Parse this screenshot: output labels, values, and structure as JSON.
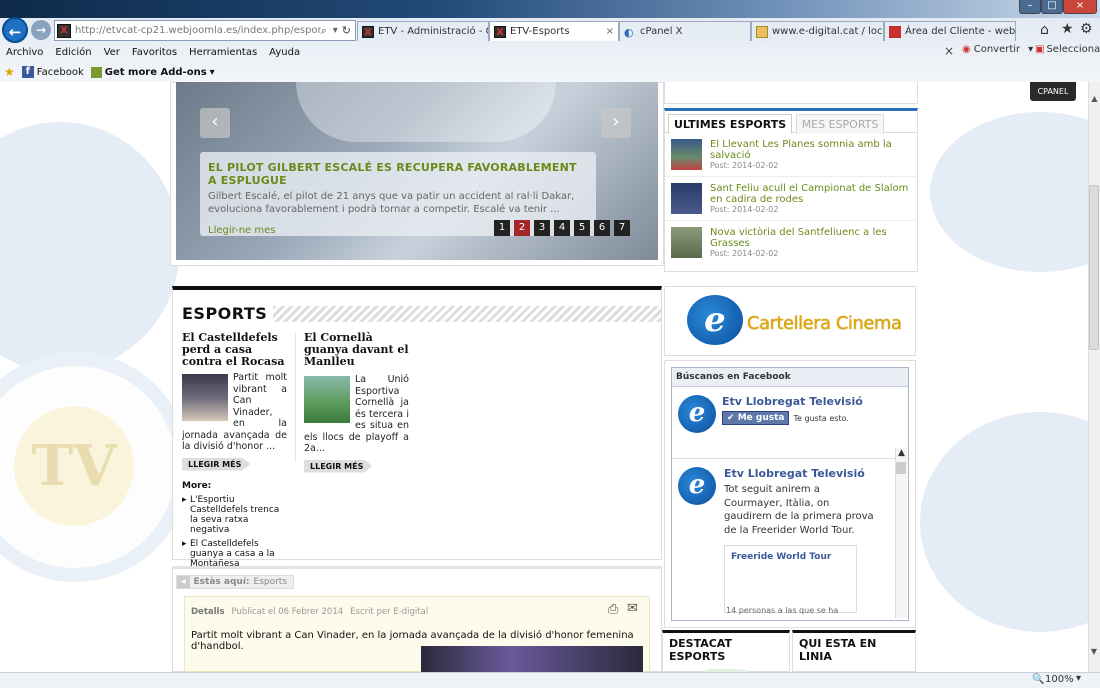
{
  "browser": {
    "address": "http://etvcat-cp21.webjoomla.es/index.php/esports",
    "tabs": [
      {
        "label": "ETV - Administració - Ges..."
      },
      {
        "label": "ETV-Esports"
      },
      {
        "label": "cPanel X"
      },
      {
        "label": "www.e-digital.cat / localh..."
      },
      {
        "label": "Área del Cliente - webem..."
      }
    ],
    "menu": [
      "Archivo",
      "Edición",
      "Ver",
      "Favoritos",
      "Herramientas",
      "Ayuda"
    ],
    "favorites": {
      "facebook": "Facebook",
      "addons": "Get more Add-ons"
    },
    "toolbar_right": {
      "convert": "Convertir",
      "select": "Seleccionar"
    },
    "zoom": "100%",
    "tab_close": "×",
    "close_glyph": "×"
  },
  "cpanel_badge": "CPANEL",
  "slider": {
    "headline": "EL PILOT GILBERT ESCALÉ ES RECUPERA FAVORABLEMENT A ESPLUGUE",
    "text": "Gilbert Escalé, el pilot de 21 anys que va patir un accident al ral·li Dakar, evoluciona favorablement i podrà tornar a competir. Escalé va tenir ...",
    "link": "Llegir-ne mes",
    "pages": [
      "1",
      "2",
      "3",
      "4",
      "5",
      "6",
      "7"
    ],
    "active_page": "2"
  },
  "sidebar_news": {
    "tab_active": "ULTIMES ESPORTS",
    "tab_inactive": "MES ESPORTS",
    "items": [
      {
        "title": "El Llevant Les Planes somnia amb la salvació",
        "date": "Post: 2014-02-02"
      },
      {
        "title": "Sant Feliu acull el Campionat de Slalom en cadira de rodes",
        "date": "Post: 2014-02-02"
      },
      {
        "title": "Nova victòria del Santfeliuenc a les Grasses",
        "date": "Post: 2014-02-02"
      }
    ]
  },
  "esports": {
    "heading": "ESPORTS",
    "articles": [
      {
        "title": "El Castelldefels perd a casa contra el Rocasa",
        "text": "Partit molt vibrant a Can Vinader, en la jornada avançada de la divisió d'honor ...",
        "readmore": "LLEGIR MÉS"
      },
      {
        "title": "El Cornellà guanya davant el Manlleu",
        "text": "La Unió Esportiva Cornellà ja és tercera i es situa en els llocs de playoff a 2a...",
        "readmore": "LLEGIR MÉS"
      }
    ],
    "more_label": "More:",
    "more_links": [
      "L'Esportiu Castelldefels trenca la seva ratxa negativa",
      "El Castelldefels guanya a casa a la Montañesa"
    ]
  },
  "cinema": {
    "label": "Cartellera Cinema",
    "logo": "TV"
  },
  "facebook": {
    "header": "Búscanos en Facebook",
    "page_name": "Etv Llobregat Televisió",
    "like_button": "Me gusta",
    "like_text": "Te gusta esto.",
    "post_author": "Etv Llobregat Televisió",
    "post_text": "Tot seguit anirem a Courmayer, Itàlia, on gaudirem de la primera prova de la Freerider World Tour.",
    "link_title": "Freeride World Tour",
    "footer": "14 personas a las que se ha"
  },
  "breadcrumb": {
    "label": "Estàs aquí:",
    "current": "Esports"
  },
  "article_detail": {
    "details": "Detalls",
    "published": "Publicat el 06 Febrer 2014",
    "author": "Escrit per E-digital",
    "body": "Partit molt vibrant a Can Vinader, en la jornada avançada de la divisió d'honor femenina d'handbol."
  },
  "bottom_boxes": {
    "destacat": "DESTACAT ESPORTS",
    "linia": "QUI ESTA EN LINIA"
  }
}
